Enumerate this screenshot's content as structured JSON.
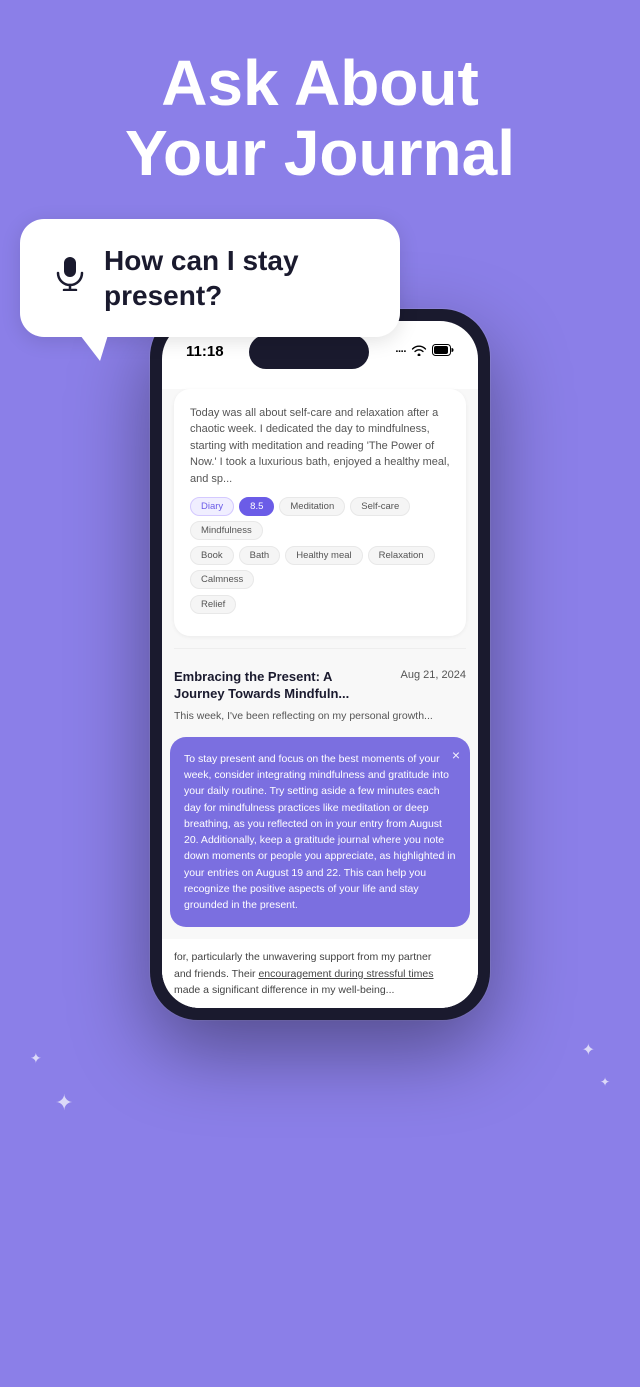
{
  "hero": {
    "title_line1": "Ask About",
    "title_line2": "Your Journal"
  },
  "speech_bubble": {
    "question": "How can I stay present?"
  },
  "phone": {
    "status_bar": {
      "time": "11:18",
      "signal": "····",
      "wifi": "wifi",
      "battery": "battery"
    }
  },
  "journal_card": {
    "body_text": "Today was all about self-care and relaxation after a chaotic week. I dedicated the day to mindfulness, starting with meditation and reading 'The Power of Now.' I took a luxurious bath, enjoyed a healthy meal, and sp...",
    "tags": [
      {
        "label": "Diary",
        "type": "diary"
      },
      {
        "label": "8.5",
        "type": "score"
      },
      {
        "label": "Meditation",
        "type": "plain"
      },
      {
        "label": "Self-care",
        "type": "plain"
      },
      {
        "label": "Mindfulness",
        "type": "plain"
      },
      {
        "label": "Book",
        "type": "plain"
      },
      {
        "label": "Bath",
        "type": "plain"
      },
      {
        "label": "Healthy meal",
        "type": "plain"
      },
      {
        "label": "Relaxation",
        "type": "plain"
      },
      {
        "label": "Calmness",
        "type": "plain"
      },
      {
        "label": "Relief",
        "type": "plain"
      }
    ]
  },
  "entry2": {
    "title": "Embracing the Present: A Journey Towards Mindfuln...",
    "date": "Aug 21, 2024",
    "body": "This week, I've been reflecting on my personal growth..."
  },
  "ai_response": {
    "text": "To stay present and focus on the best moments of your week, consider integrating mindfulness and gratitude into your daily routine. Try setting aside a few minutes each day for mindfulness practices like meditation or deep breathing, as you reflected on in your entry from August 20. Additionally, keep a gratitude journal where you note down moments or people you appreciate, as highlighted in your entries on August 19 and 22. This can help you recognize the positive aspects of your life and stay grounded in the present.",
    "close_label": "×"
  },
  "bottom_text": {
    "line1": "for, particularly the unwavering support from my partner",
    "line2": "and friends. Their ",
    "underlined": "encouragement during stressful times",
    "line3": "made a significant difference in my well-being..."
  }
}
